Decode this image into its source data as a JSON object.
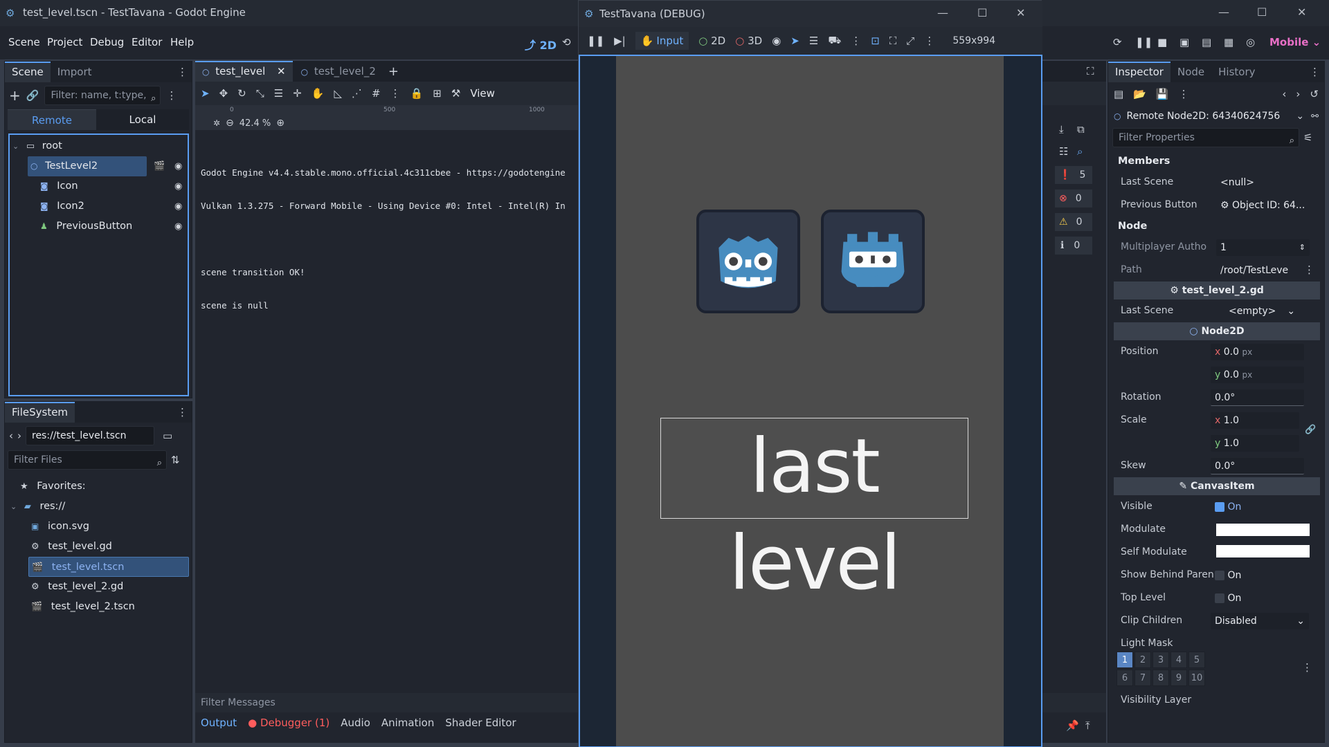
{
  "editor": {
    "title": "test_level.tscn - TestTavana - Godot Engine",
    "menus": [
      "Scene",
      "Project",
      "Debug",
      "Editor",
      "Help"
    ],
    "mode_2d": "2D",
    "renderer": "Mobile"
  },
  "scene_dock": {
    "tabs": [
      "Scene",
      "Import"
    ],
    "filter_placeholder": "Filter: name, t:type,",
    "remote_label": "Remote",
    "local_label": "Local",
    "tree": [
      {
        "label": "root",
        "icon": "window-icon"
      },
      {
        "label": "TestLevel2",
        "icon": "node2d-icon"
      },
      {
        "label": "Icon",
        "icon": "sprite-icon"
      },
      {
        "label": "Icon2",
        "icon": "sprite-icon"
      },
      {
        "label": "PreviousButton",
        "icon": "button-icon"
      }
    ]
  },
  "filesystem_dock": {
    "tab": "FileSystem",
    "path": "res://test_level.tscn",
    "filter_placeholder": "Filter Files",
    "favorites": "Favorites:",
    "root": "res://",
    "files": [
      "icon.svg",
      "test_level.gd",
      "test_level.tscn",
      "test_level_2.gd",
      "test_level_2.tscn"
    ]
  },
  "center": {
    "tabs": [
      "test_level",
      "test_level_2"
    ],
    "view_label": "View",
    "zoom": "42.4 %",
    "ruler": [
      "0",
      "500",
      "1000"
    ],
    "console_lines": [
      "Godot Engine v4.4.stable.mono.official.4c311cbee - https://godotengine",
      "Vulkan 1.3.275 - Forward Mobile - Using Device #0: Intel - Intel(R) In",
      "",
      "scene transition OK!",
      "scene is null"
    ],
    "filter_messages": "Filter Messages",
    "bottom_tabs": [
      "Output",
      "Debugger (1)",
      "Audio",
      "Animation",
      "Shader Editor"
    ],
    "counts": [
      "5",
      "0",
      "0",
      "0"
    ]
  },
  "debug_window": {
    "title": "TestTavana (DEBUG)",
    "input_label": "Input",
    "mode_2d": "2D",
    "mode_3d": "3D",
    "size": "559x994",
    "game_label": "last level"
  },
  "inspector": {
    "tabs": [
      "Inspector",
      "Node",
      "History"
    ],
    "remote_node": "Remote Node2D: 64340624756",
    "filter_placeholder": "Filter Properties",
    "members_header": "Members",
    "last_scene_label": "Last Scene",
    "last_scene_value": "<null>",
    "previous_button_label": "Previous Button",
    "previous_button_value": "Object ID: 64...",
    "node_header": "Node",
    "multiplayer_label": "Multiplayer Autho",
    "multiplayer_value": "1",
    "path_label": "Path",
    "path_value": "/root/TestLeve",
    "script_section": "test_level_2.gd",
    "script_last_scene_label": "Last Scene",
    "script_last_scene_value": "<empty>",
    "node2d_section": "Node2D",
    "position_label": "Position",
    "position_x": "0.0",
    "position_y": "0.0",
    "unit_px": "px",
    "rotation_label": "Rotation",
    "rotation_value": "0.0",
    "unit_deg": "°",
    "scale_label": "Scale",
    "scale_x": "1.0",
    "scale_y": "1.0",
    "skew_label": "Skew",
    "skew_value": "0.0",
    "canvasitem_section": "CanvasItem",
    "visible_label": "Visible",
    "on_label": "On",
    "modulate_label": "Modulate",
    "self_modulate_label": "Self Modulate",
    "show_behind_label": "Show Behind Paren",
    "top_level_label": "Top Level",
    "clip_children_label": "Clip Children",
    "clip_children_value": "Disabled",
    "light_mask_label": "Light Mask",
    "light_mask_cells": [
      "1",
      "2",
      "3",
      "4",
      "5",
      "6",
      "7",
      "8",
      "9",
      "10"
    ],
    "visibility_layer_label": "Visibility Layer"
  },
  "colors": {
    "accent": "#5a9df2",
    "renderer_mobile": "#e86fc6",
    "debugger_red": "#ff5d5d"
  }
}
